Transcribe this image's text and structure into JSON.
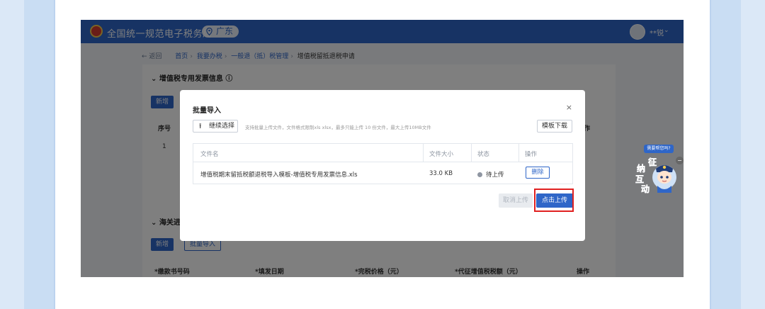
{
  "header": {
    "app_title": "全国统一规范电子税务局",
    "region": "广东",
    "user": "**锐"
  },
  "breadcrumb": {
    "back": "返回",
    "items": [
      "首页",
      "我要办税",
      "一般退（抵）税管理"
    ],
    "current": "增值税留抵退税申请"
  },
  "background_page": {
    "section1_title": "增值税专用发票信息",
    "section1_new": "新增",
    "row_index_header": "序号",
    "row_index": "1",
    "action_header_tail": "作",
    "section2_title": "海关进",
    "section2_new": "新增",
    "section2_import": "批量导入",
    "columns": [
      "*缴款书号码",
      "*填发日期",
      "*完税价格（元）",
      "*代征增值税税额（元）",
      "操作"
    ]
  },
  "modal": {
    "title": "批量导入",
    "close": "×",
    "continue_select": "继续选择",
    "hint": "支持批量上传文件，文件格式限制xls  xlsx，最多只能上传 10 份文件，最大上传10MB文件",
    "template_download": "模板下载",
    "table_headers": {
      "file_name": "文件名",
      "file_size": "文件大小",
      "status": "状态",
      "action": "操作"
    },
    "file": {
      "name": "增值税期末留抵税额退税导入模板-增值税专用发票信息.xls",
      "size": "33.0 KB",
      "status": "待上传",
      "delete": "删除"
    },
    "cancel_upload": "取消上传",
    "click_upload": "点击上传"
  },
  "assistant": {
    "bubble": "需要帮您吗?",
    "chars": [
      "征",
      "纳",
      "互",
      "动"
    ]
  },
  "colors": {
    "brand_blue": "#2f66c8",
    "highlight_red": "#e02020",
    "background": "#c9ddf3"
  }
}
